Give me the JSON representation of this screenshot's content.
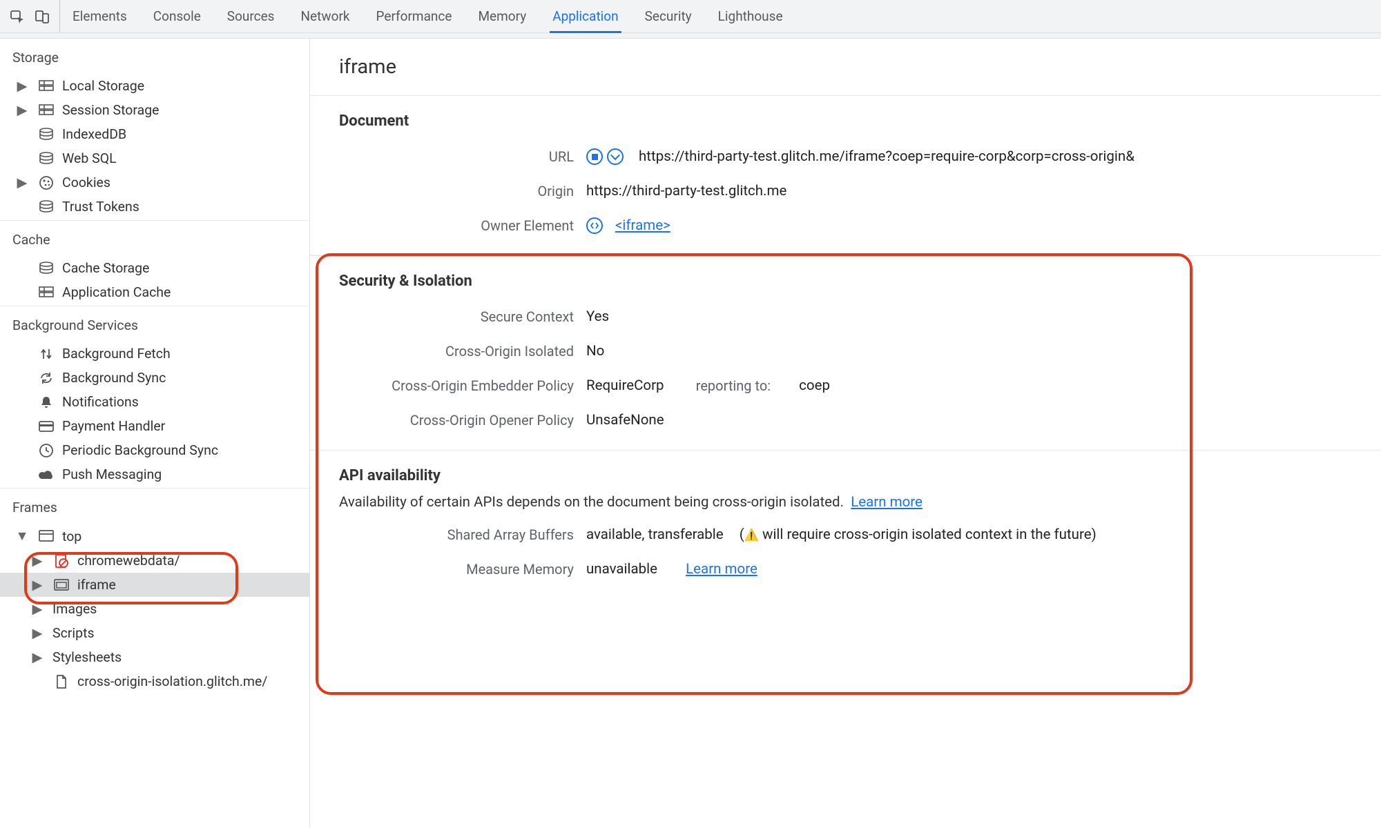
{
  "toolbar": {
    "tabs": [
      "Elements",
      "Console",
      "Sources",
      "Network",
      "Performance",
      "Memory",
      "Application",
      "Security",
      "Lighthouse"
    ],
    "active_index": 6
  },
  "sidebar": {
    "sections": {
      "storage": {
        "label": "Storage",
        "items": [
          {
            "label": "Local Storage",
            "expandable": true
          },
          {
            "label": "Session Storage",
            "expandable": true
          },
          {
            "label": "IndexedDB",
            "expandable": false
          },
          {
            "label": "Web SQL",
            "expandable": false
          },
          {
            "label": "Cookies",
            "expandable": true
          },
          {
            "label": "Trust Tokens",
            "expandable": false
          }
        ]
      },
      "cache": {
        "label": "Cache",
        "items": [
          {
            "label": "Cache Storage",
            "expandable": false
          },
          {
            "label": "Application Cache",
            "expandable": false
          }
        ]
      },
      "bg": {
        "label": "Background Services",
        "items": [
          {
            "label": "Background Fetch"
          },
          {
            "label": "Background Sync"
          },
          {
            "label": "Notifications"
          },
          {
            "label": "Payment Handler"
          },
          {
            "label": "Periodic Background Sync"
          },
          {
            "label": "Push Messaging"
          }
        ]
      },
      "frames": {
        "label": "Frames",
        "top": "top",
        "children": [
          {
            "label": "chromewebdata/",
            "icon": "red-page"
          },
          {
            "label": "iframe",
            "icon": "frame",
            "selected": true
          }
        ],
        "rest": [
          {
            "label": "Images"
          },
          {
            "label": "Scripts"
          },
          {
            "label": "Stylesheets"
          },
          {
            "label": "cross-origin-isolation.glitch.me/",
            "icon": "page"
          }
        ]
      }
    }
  },
  "main": {
    "title": "iframe",
    "document": {
      "label": "Document",
      "url_label": "URL",
      "url": "https://third-party-test.glitch.me/iframe?coep=require-corp&corp=cross-origin&",
      "origin_label": "Origin",
      "origin": "https://third-party-test.glitch.me",
      "owner_label": "Owner Element",
      "owner_link": "<iframe>"
    },
    "security": {
      "label": "Security & Isolation",
      "rows": {
        "secure": {
          "k": "Secure Context",
          "v": "Yes"
        },
        "coi": {
          "k": "Cross-Origin Isolated",
          "v": "No"
        },
        "coep": {
          "k": "Cross-Origin Embedder Policy",
          "v": "RequireCorp",
          "extra_label": "reporting to:",
          "extra_value": "coep"
        },
        "coop": {
          "k": "Cross-Origin Opener Policy",
          "v": "UnsafeNone"
        }
      }
    },
    "api": {
      "label": "API availability",
      "desc": "Availability of certain APIs depends on the document being cross-origin isolated.",
      "learn": "Learn more",
      "rows": {
        "sab": {
          "k": "Shared Array Buffers",
          "v": "available, transferable",
          "warn": "will require cross-origin isolated context in the future)"
        },
        "mm": {
          "k": "Measure Memory",
          "v": "unavailable",
          "link": "Learn more"
        }
      }
    }
  }
}
